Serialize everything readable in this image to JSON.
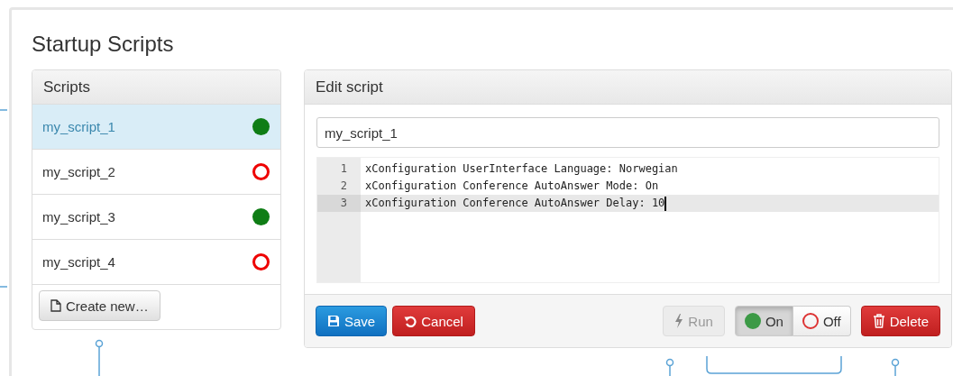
{
  "page_title": "Startup Scripts",
  "scripts_panel": {
    "title": "Scripts",
    "items": [
      {
        "name": "my_script_1",
        "selected": true,
        "active": true
      },
      {
        "name": "my_script_2",
        "selected": false,
        "active": false
      },
      {
        "name": "my_script_3",
        "selected": false,
        "active": true
      },
      {
        "name": "my_script_4",
        "selected": false,
        "active": false
      }
    ],
    "create_button": "Create new…"
  },
  "editor_panel": {
    "title": "Edit script",
    "name_value": "my_script_1",
    "lines": [
      {
        "number": "1",
        "code": "xConfiguration UserInterface Language: Norwegian",
        "selected": false
      },
      {
        "number": "2",
        "code": "xConfiguration Conference AutoAnswer Mode: On",
        "selected": false
      },
      {
        "number": "3",
        "code": "xConfiguration Conference AutoAnswer Delay: 10",
        "selected": true
      }
    ],
    "save_button": "Save",
    "cancel_button": "Cancel",
    "run_button": {
      "label": "Run",
      "disabled": true
    },
    "toggle": [
      {
        "label": "On",
        "kind": "on",
        "selected": true
      },
      {
        "label": "Off",
        "kind": "off",
        "selected": false
      }
    ],
    "delete_button": "Delete"
  }
}
